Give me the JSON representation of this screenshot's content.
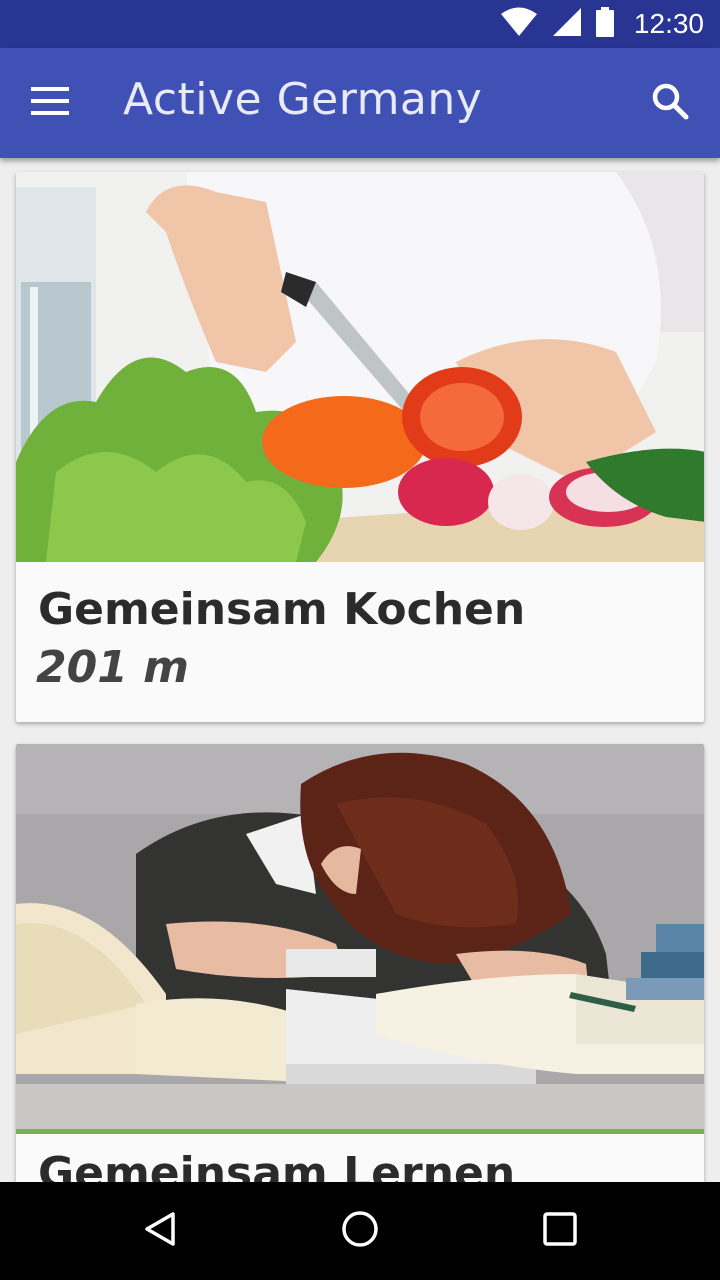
{
  "status_bar": {
    "time": "12:30",
    "icons": [
      "wifi-icon",
      "cell-signal-icon",
      "battery-icon"
    ]
  },
  "app_bar": {
    "title": "Active Germany",
    "menu_icon": "hamburger-menu-icon",
    "search_icon": "search-icon",
    "color": "#3f51b5",
    "status_color": "#283593"
  },
  "cards": [
    {
      "title": "Gemeinsam Kochen",
      "distance": "201 m",
      "image": "photo of hands chopping vegetables"
    },
    {
      "title": "Gemeinsam Lernen",
      "image": "photo of a woman asleep on stacked books"
    }
  ],
  "nav_bar": {
    "icons": [
      "back-icon",
      "home-icon",
      "recents-icon"
    ]
  }
}
